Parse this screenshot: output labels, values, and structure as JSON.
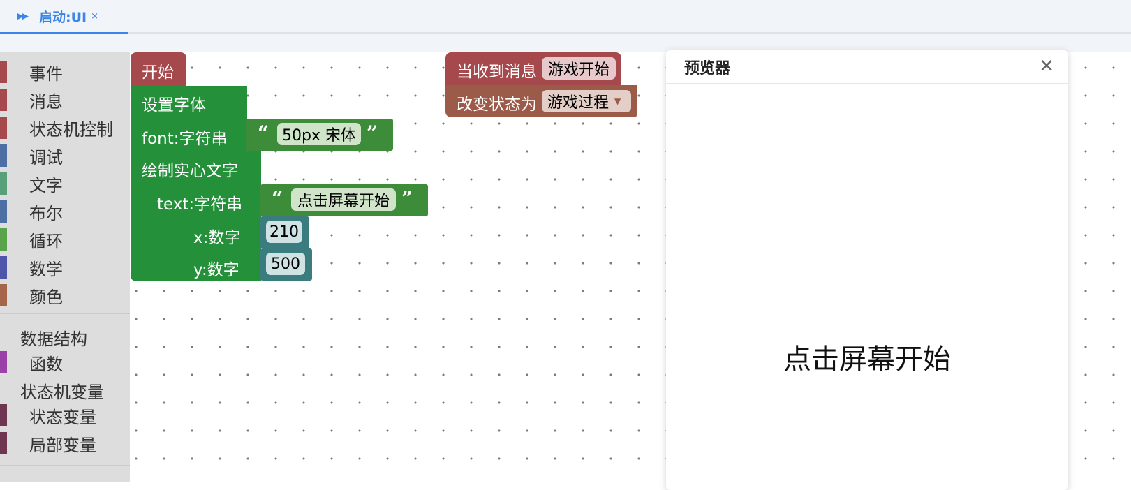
{
  "tab": {
    "icon": "play-forward-icon",
    "label": "启动:UI",
    "close": "×"
  },
  "toolbox": {
    "categories": [
      {
        "label": "事件",
        "color": "#a5494d"
      },
      {
        "label": "消息",
        "color": "#a5494d"
      },
      {
        "label": "状态机控制",
        "color": "#a5494d"
      },
      {
        "label": "调试",
        "color": "#4e6fa3"
      },
      {
        "label": "文字",
        "color": "#57a07a"
      },
      {
        "label": "布尔",
        "color": "#4e6fa3"
      },
      {
        "label": "循环",
        "color": "#59a34c"
      },
      {
        "label": "数学",
        "color": "#4f55a8"
      },
      {
        "label": "颜色",
        "color": "#a5654a"
      }
    ],
    "data_structure": "数据结构",
    "functions": {
      "label": "函数",
      "color": "#9b42a8"
    },
    "fsm_vars": "状态机变量",
    "state_var": {
      "label": "状态变量",
      "color": "#6e3650"
    },
    "local_var": {
      "label": "局部变量",
      "color": "#6e3650"
    }
  },
  "blocks": {
    "start": "开始",
    "set_font": "设置字体",
    "font_param": "font:字符串",
    "font_value": "50px 宋体",
    "draw_text": "绘制实心文字",
    "text_param": "text:字符串",
    "text_value": "点击屏幕开始",
    "x_param": "x:数字",
    "x_value": "210",
    "y_param": "y:数字",
    "y_value": "500",
    "on_message": "当收到消息",
    "message_value": "游戏开始",
    "change_state": "改变状态为",
    "state_value": "游戏过程",
    "open_quote": "“",
    "close_quote": "”"
  },
  "preview": {
    "title": "预览器",
    "close_icon": "close-icon",
    "canvas_text": "点击屏幕开始"
  },
  "colors": {
    "event": "#a5494d",
    "text_block": "#24913a",
    "string_value": "#3c8c39",
    "number_value": "#3b7c7e",
    "state_block": "#9c5a48",
    "accent": "#3a86e8"
  }
}
